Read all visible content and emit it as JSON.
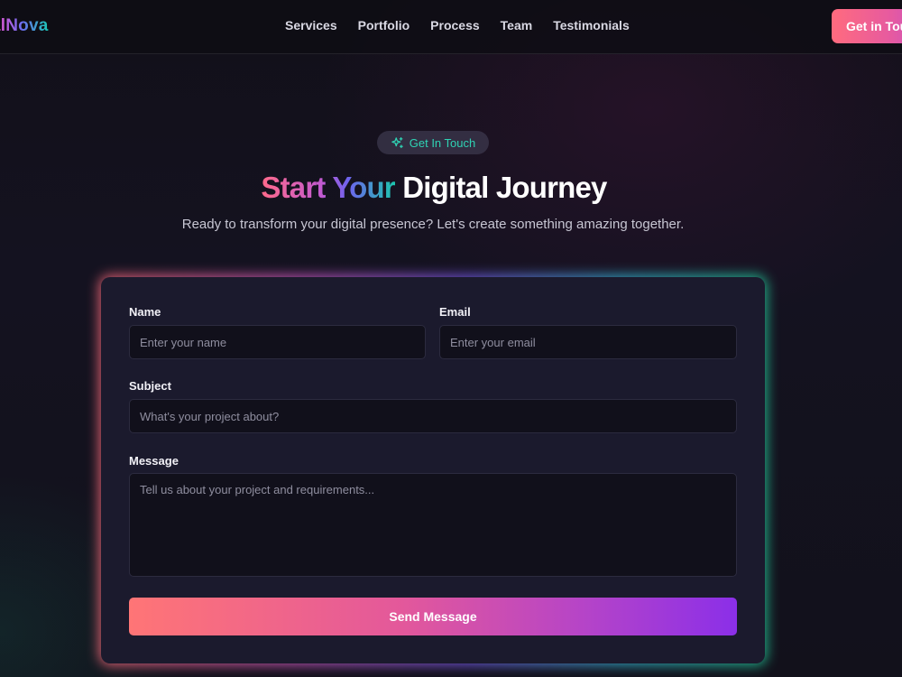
{
  "header": {
    "logo": "italNova",
    "nav": [
      "Services",
      "Portfolio",
      "Process",
      "Team",
      "Testimonials"
    ],
    "cta_label": "Get in Tou"
  },
  "hero": {
    "badge_label": "Get In Touch",
    "title_gradient": "Start Your",
    "title_plain": "Digital Journey",
    "subtitle": "Ready to transform your digital presence? Let's create something amazing together."
  },
  "form": {
    "name": {
      "label": "Name",
      "placeholder": "Enter your name",
      "value": ""
    },
    "email": {
      "label": "Email",
      "placeholder": "Enter your email",
      "value": ""
    },
    "subject": {
      "label": "Subject",
      "placeholder": "What's your project about?",
      "value": ""
    },
    "message": {
      "label": "Message",
      "placeholder": "Tell us about your project and requirements...",
      "value": ""
    },
    "submit_label": "Send Message"
  },
  "icons": {
    "badge_icon": "sparkles-icon"
  },
  "colors": {
    "accent_teal": "#2fd3b4",
    "accent_pink": "#ff6b7e",
    "accent_purple": "#8b2fe8",
    "card_bg": "#1b1a2d"
  }
}
